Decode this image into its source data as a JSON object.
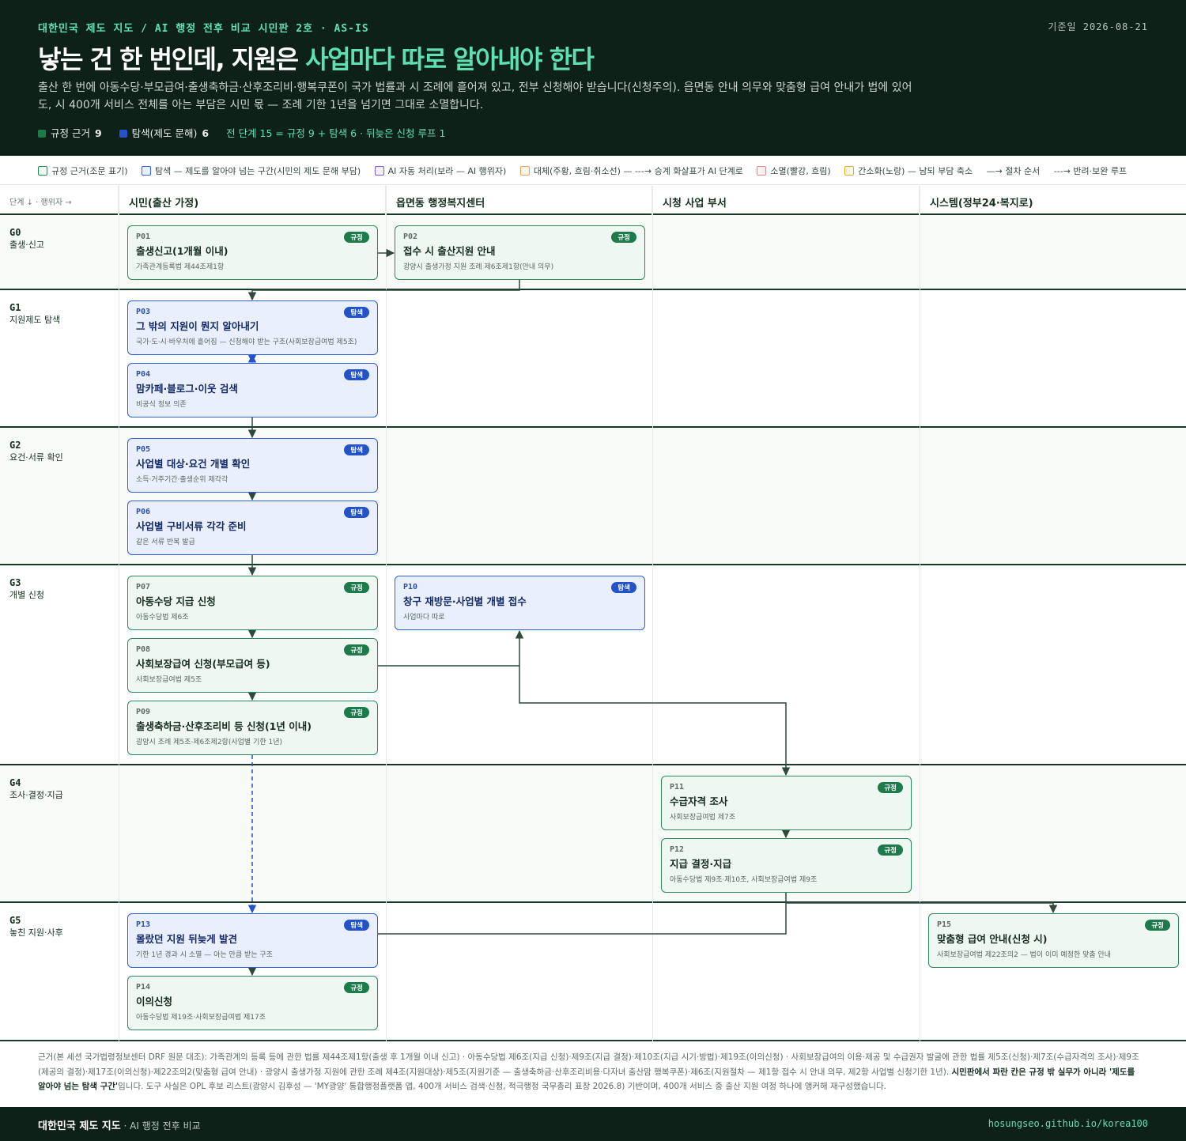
{
  "header": {
    "eyebrow": "대한민국 제도 지도 / AI 행정 전후 비교 시민판 2호 · AS-IS",
    "as_of": "기준일 2026-08-21",
    "title_plain": "낳는 건 한 번인데, 지원은 ",
    "title_highlight": "사업마다 따로 알아내야 한다",
    "lead": "출산 한 번에 아동수당·부모급여·출생축하금·산후조리비·행복쿠폰이 국가 법률과 시 조례에 흩어져 있고, 전부 신청해야 받습니다(신청주의). 읍면동 안내 의무와 맞춤형 급여 안내가 법에 있어도, 시 400개 서비스 전체를 아는 부담은 시민 몫 — 조례 기한 1년을 넘기면 그대로 소멸합니다.",
    "stat_rule_label": "규정 근거",
    "stat_rule_value": "9",
    "stat_exp_label": "탐색(제도 문해)",
    "stat_exp_value": "6",
    "stat_note": "전 단계 15 = 규정 9 + 탐색 6 · 뒤늦은 신청 루프 1",
    "colors": {
      "bg": "#0e2118",
      "accent": "#5ee0b0",
      "rule": "#1c7a4b",
      "explore": "#2452c9"
    }
  },
  "legend": [
    {
      "label": "규정 근거(조문 표기)",
      "color": "#2a8b5a",
      "icon": "legend-rule-swatch"
    },
    {
      "label": "탐색 — 제도를 알아야 넘는 구간(시민의 제도 문해 부담)",
      "color": "#2d5fd6",
      "icon": "legend-explore-swatch"
    },
    {
      "label": "AI 자동 처리(보라 — AI 행위자)",
      "color": "#7b5cd6",
      "icon": "legend-ai-swatch"
    },
    {
      "label": "대체(주황, 흐림·취소선) — ---→ 승계 화살표가 AI 단계로",
      "color": "#e0a060",
      "icon": "legend-replace-swatch"
    },
    {
      "label": "소멸(빨강, 흐림)",
      "color": "#e08a8a",
      "icon": "legend-extinct-swatch"
    },
    {
      "label": "간소화(노랑) — 남되 부담 축소",
      "color": "#d9b02a",
      "icon": "legend-simplify-swatch"
    },
    {
      "label": "—→ 절차 순서",
      "color": "",
      "icon": ""
    },
    {
      "label": "---→ 반려·보완 루프",
      "color": "",
      "icon": ""
    }
  ],
  "columns": {
    "stage_header": "단계 ↓ · 행위자 →",
    "lanes": [
      "시민(출산 가정)",
      "읍면동 행정복지센터",
      "시청 사업 부서",
      "시스템(정부24·복지로)"
    ]
  },
  "stages": [
    {
      "code": "G0",
      "name": "출생·신고"
    },
    {
      "code": "G1",
      "name": "지원제도 탐색"
    },
    {
      "code": "G2",
      "name": "요건·서류 확인"
    },
    {
      "code": "G3",
      "name": "개별 신청"
    },
    {
      "code": "G4",
      "name": "조사·결정·지급"
    },
    {
      "code": "G5",
      "name": "놓친 지원·사후"
    }
  ],
  "nodes": [
    {
      "id": "P01",
      "type": "rule",
      "tag": "규정",
      "title": "출생신고(1개월 이내)",
      "sub": "가족관계등록법 제44조제1항"
    },
    {
      "id": "P02",
      "type": "rule",
      "tag": "규정",
      "title": "접수 시 출산지원 안내",
      "sub": "광양시 출생가정 지원 조례 제6조제1항(안내 의무)"
    },
    {
      "id": "P03",
      "type": "exp",
      "tag": "탐색",
      "title": "그 밖의 지원이 뭔지 알아내기",
      "sub": "국가·도·시·바우처에 흩어짐 — 신청해야 받는 구조(사회보장급여법 제5조)"
    },
    {
      "id": "P04",
      "type": "exp",
      "tag": "탐색",
      "title": "맘카페·블로그·이웃 검색",
      "sub": "비공식 정보 의존"
    },
    {
      "id": "P05",
      "type": "exp",
      "tag": "탐색",
      "title": "사업별 대상·요건 개별 확인",
      "sub": "소득·거주기간·출생순위 제각각"
    },
    {
      "id": "P06",
      "type": "exp",
      "tag": "탐색",
      "title": "사업별 구비서류 각각 준비",
      "sub": "같은 서류 반복 발급"
    },
    {
      "id": "P07",
      "type": "rule",
      "tag": "규정",
      "title": "아동수당 지급 신청",
      "sub": "아동수당법 제6조"
    },
    {
      "id": "P08",
      "type": "rule",
      "tag": "규정",
      "title": "사회보장급여 신청(부모급여 등)",
      "sub": "사회보장급여법 제5조"
    },
    {
      "id": "P09",
      "type": "rule",
      "tag": "규정",
      "title": "출생축하금·산후조리비 등 신청(1년 이내)",
      "sub": "광양시 조례 제5조·제6조제2항(사업별 기한 1년)"
    },
    {
      "id": "P10",
      "type": "exp",
      "tag": "탐색",
      "title": "창구 재방문·사업별 개별 접수",
      "sub": "사업마다 따로"
    },
    {
      "id": "P11",
      "type": "rule",
      "tag": "규정",
      "title": "수급자격 조사",
      "sub": "사회보장급여법 제7조"
    },
    {
      "id": "P12",
      "type": "rule",
      "tag": "규정",
      "title": "지급 결정·지급",
      "sub": "아동수당법 제9조·제10조, 사회보장급여법 제9조"
    },
    {
      "id": "P13",
      "type": "exp",
      "tag": "탐색",
      "title": "몰랐던 지원 뒤늦게 발견",
      "sub": "기한 1년 경과 시 소멸 — 아는 만큼 받는 구조"
    },
    {
      "id": "P14",
      "type": "rule",
      "tag": "규정",
      "title": "이의신청",
      "sub": "아동수당법 제19조·사회보장급여법 제17조"
    },
    {
      "id": "P15",
      "type": "rule",
      "tag": "규정",
      "title": "맞춤형 급여 안내(신청 시)",
      "sub": "사회보장급여법 제22조의2 — 법이 이미 예정한 맞춤 안내"
    }
  ],
  "footnote": {
    "text": "근거(본 세션 국가법령정보센터 DRF 원문 대조): 가족관계의 등록 등에 관한 법률 제44조제1항(출생 후 1개월 이내 신고) · 아동수당법 제6조(지급 신청)·제9조(지급 결정)·제10조(지급 시기·방법)·제19조(이의신청) · 사회보장급여의 이용·제공 및 수급권자 발굴에 관한 법률 제5조(신청)·제7조(수급자격의 조사)·제9조(제공의 결정)·제17조(이의신청)·제22조의2(맞춤형 급여 안내) · 광양시 출생가정 지원에 관한 조례 제4조(지원대상)·제5조(지원기준 — 출생축하금·산후조리비용·다자녀 출산맘 행복쿠폰)·제6조(지원절차 — 제1항 접수 시 안내 의무, 제2항 사업별 신청기한 1년). ",
    "bold": "시민판에서 파란 칸은 규정 밖 실무가 아니라 '제도를 알아야 넘는 탐색 구간'",
    "tail": "입니다. 도구 사실은 OPL 후보 리스트(광양시 김후성 — 'MY광양' 통합행정플랫폼 앱, 400개 서비스 검색·신청, 적극행정 국무총리 표창 2026.8) 기반이며, 400개 서비스 중 출산 지원 여정 하나에 앵커해 재구성했습니다."
  },
  "footer": {
    "brand": "대한민국 제도 지도",
    "sub": " · AI 행정 전후 비교",
    "url": "hosungseo.github.io/korea100"
  }
}
